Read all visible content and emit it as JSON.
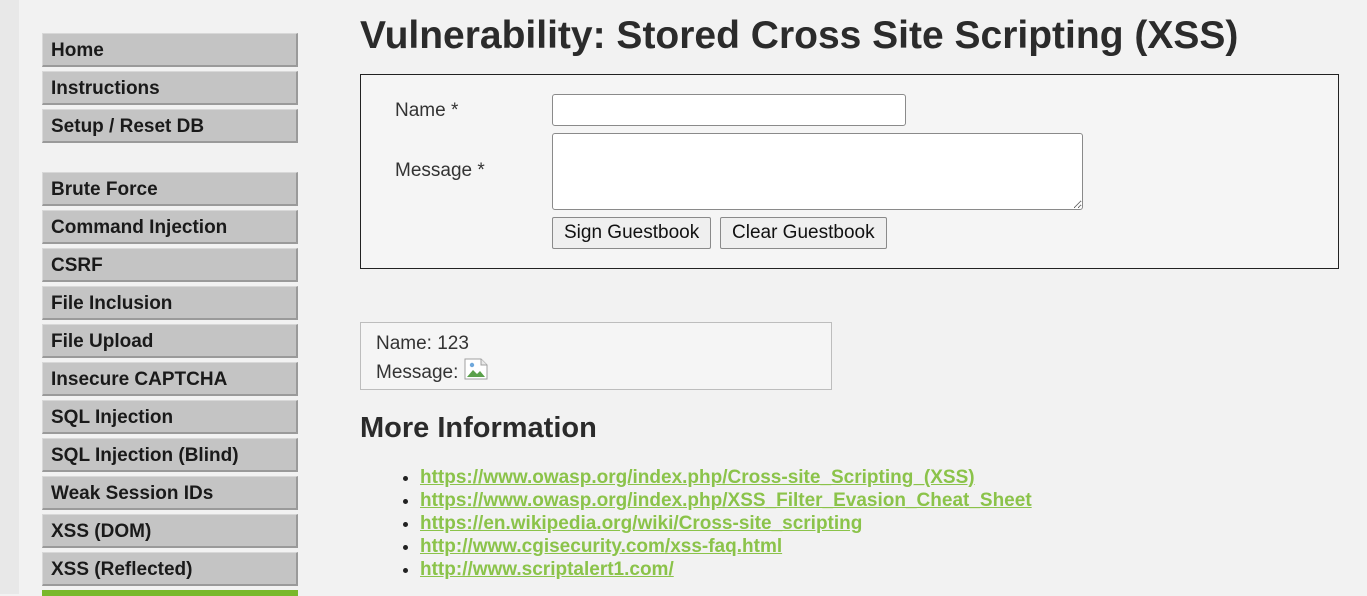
{
  "sidebar": {
    "group1": [
      "Home",
      "Instructions",
      "Setup / Reset DB"
    ],
    "group2": [
      "Brute Force",
      "Command Injection",
      "CSRF",
      "File Inclusion",
      "File Upload",
      "Insecure CAPTCHA",
      "SQL Injection",
      "SQL Injection (Blind)",
      "Weak Session IDs",
      "XSS (DOM)",
      "XSS (Reflected)"
    ]
  },
  "main": {
    "title": "Vulnerability: Stored Cross Site Scripting (XSS)",
    "form": {
      "name_label": "Name *",
      "name_value": "",
      "message_label": "Message *",
      "message_value": "",
      "sign_button": "Sign Guestbook",
      "clear_button": "Clear Guestbook"
    },
    "entry": {
      "name_line": "Name: 123",
      "message_line": "Message:"
    },
    "more_info": {
      "title": "More Information",
      "links": [
        "https://www.owasp.org/index.php/Cross-site_Scripting_(XSS)",
        "https://www.owasp.org/index.php/XSS_Filter_Evasion_Cheat_Sheet",
        "https://en.wikipedia.org/wiki/Cross-site_scripting",
        "http://www.cgisecurity.com/xss-faq.html",
        "http://www.scriptalert1.com/"
      ]
    }
  },
  "colors": {
    "link": "#8bc34a",
    "active_menu": "#7ab82b",
    "menu_bg": "#c4c4c4"
  }
}
